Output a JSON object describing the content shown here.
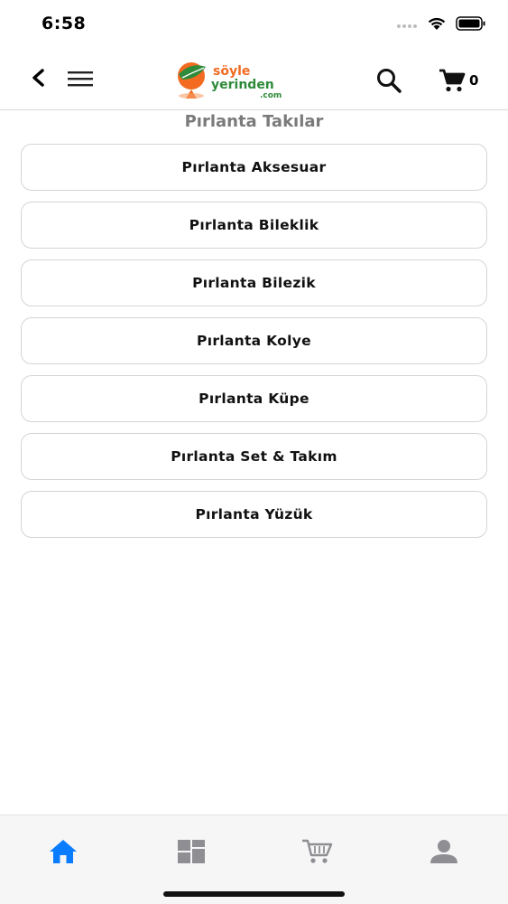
{
  "status_bar": {
    "time": "6:58"
  },
  "nav": {
    "logo_text_line1": "söyle",
    "logo_text_line2": "yerinden",
    "logo_text_line3": ".com",
    "cart_count": "0"
  },
  "page": {
    "title": "Pırlanta Takılar"
  },
  "categories": [
    {
      "label": "Pırlanta Aksesuar"
    },
    {
      "label": "Pırlanta Bileklik"
    },
    {
      "label": "Pırlanta Bilezik"
    },
    {
      "label": "Pırlanta Kolye"
    },
    {
      "label": "Pırlanta Küpe"
    },
    {
      "label": "Pırlanta Set & Takım"
    },
    {
      "label": "Pırlanta Yüzük"
    }
  ],
  "tab_bar": {
    "items": [
      {
        "icon": "home-icon",
        "active": true
      },
      {
        "icon": "categories-icon",
        "active": false
      },
      {
        "icon": "cart-icon",
        "active": false
      },
      {
        "icon": "profile-icon",
        "active": false
      }
    ]
  },
  "colors": {
    "accent": "#0a7cff",
    "tab_inactive": "#8e8e93",
    "logo_orange": "#f26b21",
    "logo_green": "#2e8b3a",
    "title_gray": "#7a7a7a",
    "border": "#d4d4d4"
  }
}
